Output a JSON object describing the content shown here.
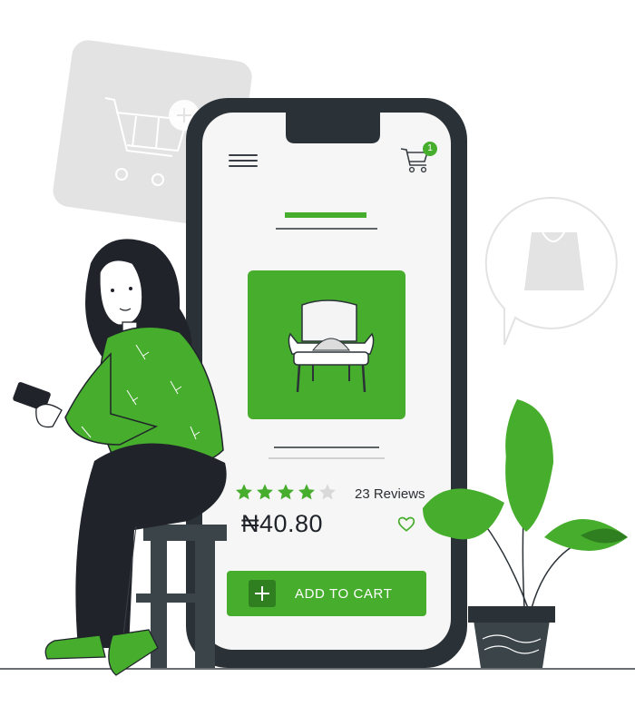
{
  "cart": {
    "count": "1"
  },
  "product": {
    "rating": 4,
    "rating_max": 5,
    "reviews": "23 Reviews",
    "price": "₦40.80"
  },
  "actions": {
    "add_to_cart": "ADD TO CART"
  },
  "colors": {
    "accent": "#46ad2d",
    "accent_dark": "#2f7f20",
    "phone_frame": "#2b3237",
    "screen": "#f6f6f6",
    "decor_gray": "#e2e2e2"
  }
}
